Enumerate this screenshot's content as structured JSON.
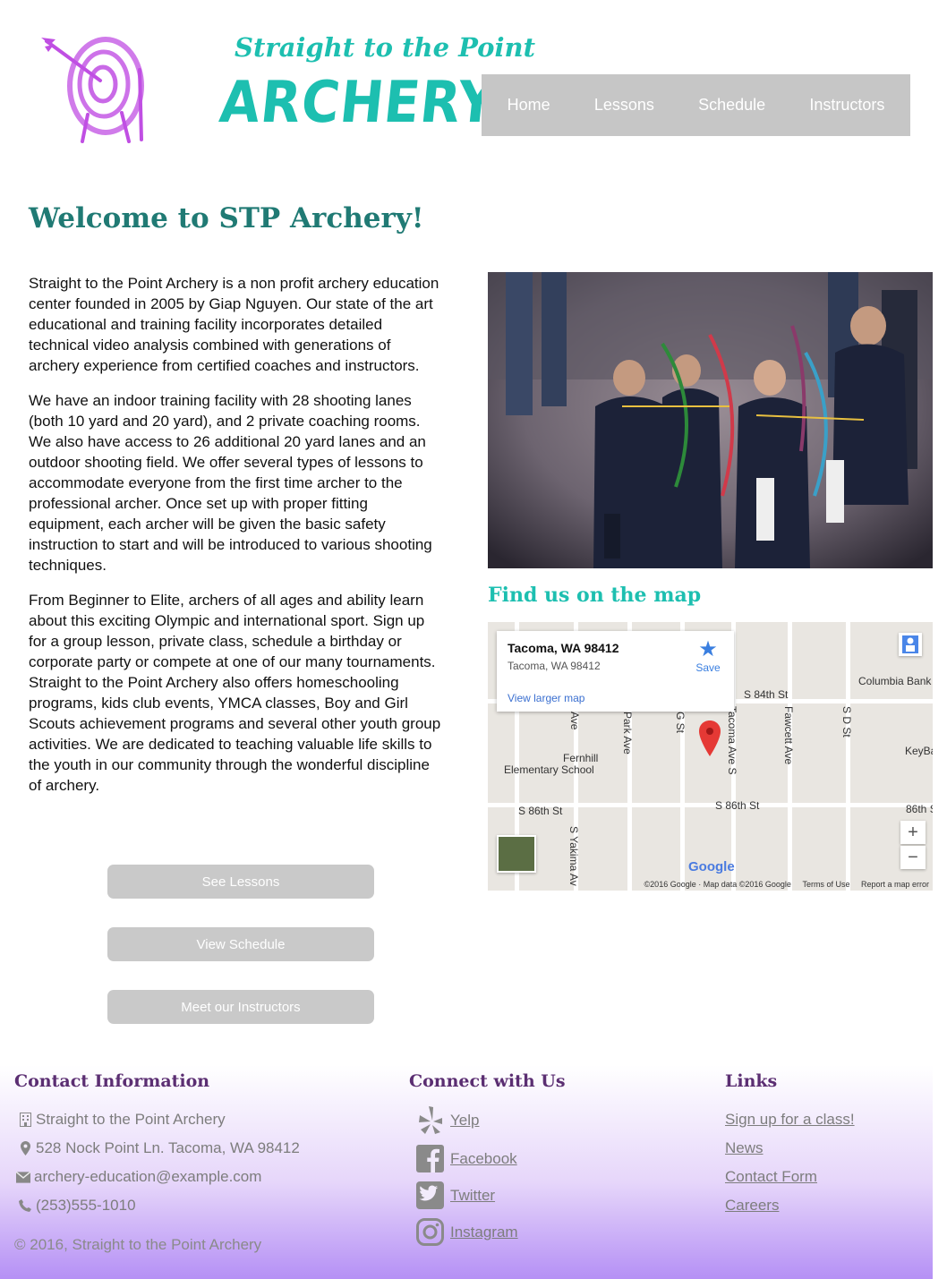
{
  "logo": {
    "top_text": "Straight to the Point",
    "main_text": "ARCHERY",
    "brand_color": "#1dbfb0",
    "target_color": "#c04fe3"
  },
  "nav": {
    "items": [
      "Home",
      "Lessons",
      "Schedule",
      "Instructors"
    ]
  },
  "main": {
    "title": "Welcome to STP Archery!",
    "paragraphs": [
      "Straight to the Point Archery is a non profit archery education center founded in 2005 by Giap Nguyen. Our state of the art educational and training facility incorporates detailed technical video analysis combined with generations of archery experience from certified coaches and instructors.",
      "We have an indoor training facility with 28 shooting lanes (both 10 yard and 20 yard), and 2 private coaching rooms. We also have access to 26 additional 20 yard lanes and an outdoor shooting field. We offer several types of lessons to accommodate everyone from the first time archer to the professional archer. Once set up with proper fitting equipment, each archer will be given the basic safety instruction to start and will be introduced to various shooting techniques.",
      "From Beginner to Elite, archers of all ages and ability learn about this exciting Olympic and international sport. Sign up for a group lesson, private class, schedule a birthday or corporate party or compete at one of our many tournaments.  Straight to the Point Archery also offers homeschooling programs, kids club events, YMCA classes, Boy and Girl Scouts achievement programs and several other youth group activities. We are dedicated to teaching valuable life skills to the youth in our community through the wonderful discipline of archery."
    ],
    "buttons": {
      "lessons": "See Lessons",
      "schedule": "View Schedule",
      "instructors": "Meet our Instructors"
    }
  },
  "map": {
    "title": "Find us on the map",
    "place_name": "Tacoma, WA 98412",
    "place_address": "Tacoma, WA 98412",
    "save": "Save",
    "larger_link": "View larger map",
    "streets": {
      "s84": "S 84th St",
      "s86a": "S 86th St",
      "s86b": "S 86th St",
      "s86c": "86th S",
      "yakima": "S Yakima Av",
      "park": "Park Ave",
      "g": "G St",
      "tacoma": "Tacoma Ave S",
      "fawcett": "Fawcett Ave",
      "sd": "S D St",
      "ave": "Ave"
    },
    "pois": {
      "school_line1": "Fernhill",
      "school_line2": "Elementary School",
      "bank": "Columbia Bank",
      "keyb": "KeyBa"
    },
    "logo": "Google",
    "footer": {
      "copyright": "©2016 Google · Map data ©2016 Google",
      "terms": "Terms of Use",
      "report": "Report a map error"
    }
  },
  "footer": {
    "contact": {
      "heading": "Contact Information",
      "name": "Straight to the Point Archery",
      "address": "528 Nock Point Ln. Tacoma, WA 98412",
      "email": "archery-education@example.com",
      "phone": "(253)555-1010"
    },
    "connect": {
      "heading": "Connect with Us",
      "items": [
        "Yelp",
        "Facebook",
        "Twitter",
        "Instagram"
      ]
    },
    "links": {
      "heading": "Links",
      "items": [
        "Sign up for a class!",
        "News",
        "Contact Form",
        "Careers"
      ]
    },
    "copyright": "© 2016, Straight to the Point Archery"
  }
}
